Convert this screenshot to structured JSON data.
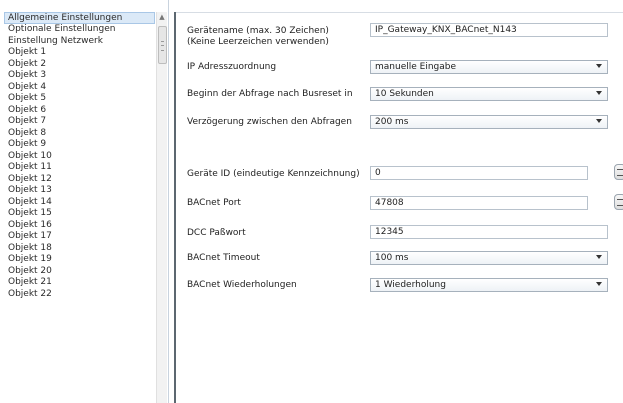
{
  "nav": {
    "items": [
      "Allgemeine Einstellungen",
      "Optionale Einstellungen",
      "Einstellung Netzwerk",
      "Objekt 1",
      "Objekt 2",
      "Objekt 3",
      "Objekt 4",
      "Objekt 5",
      "Objekt 6",
      "Objekt 7",
      "Objekt 8",
      "Objekt 9",
      "Objekt 10",
      "Objekt 11",
      "Objekt 12",
      "Objekt 13",
      "Objekt 14",
      "Objekt 15",
      "Objekt 16",
      "Objekt 17",
      "Objekt 18",
      "Objekt 19",
      "Objekt 20",
      "Objekt 21",
      "Objekt 22"
    ],
    "selected_index": 0
  },
  "settings": {
    "device_name": {
      "label_line1": "Gerätename (max. 30 Zeichen)",
      "label_line2": "(Keine Leerzeichen verwenden)",
      "value": "IP_Gateway_KNX_BACnet_N143"
    },
    "ip_assignment": {
      "label": "IP Adresszuordnung",
      "value": "manuelle Eingabe"
    },
    "query_start": {
      "label": "Beginn der Abfrage nach Busreset in",
      "value": "10 Sekunden"
    },
    "query_delay": {
      "label": "Verzögerung zwischen den Abfragen",
      "value": "200 ms"
    },
    "device_id": {
      "label": "Geräte ID (eindeutige Kennzeichnung)",
      "value": "0"
    },
    "bacnet_port": {
      "label": "BACnet Port",
      "value": "47808"
    },
    "dcc_password": {
      "label": "DCC Paßwort",
      "value": "12345"
    },
    "bacnet_timeout": {
      "label": "BACnet Timeout",
      "value": "100 ms"
    },
    "bacnet_retries": {
      "label": "BACnet Wiederholungen",
      "value": "1 Wiederholung"
    }
  },
  "colors": {
    "selection_bg": "#dbe9f7",
    "divider": "#5c6770"
  }
}
